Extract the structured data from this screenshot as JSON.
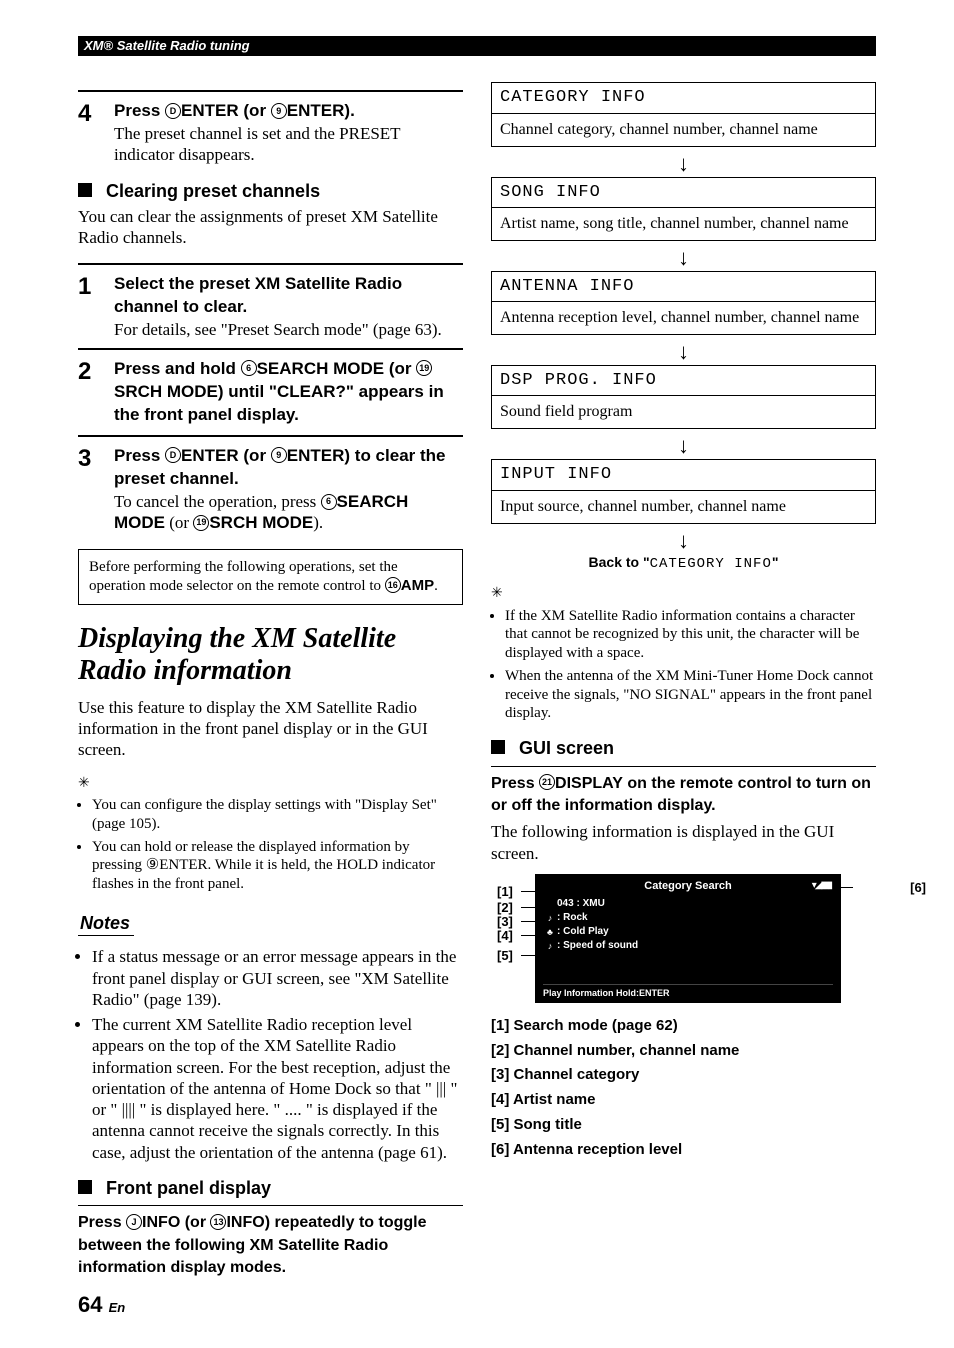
{
  "header": "XM® Satellite Radio tuning",
  "left": {
    "step4": {
      "num": "4",
      "head_pre": "Press ",
      "c1": "D",
      "b1": "ENTER",
      "mid": " (or ",
      "c2": "9",
      "b2": "ENTER",
      "post": ").",
      "body": "The preset channel is set and the PRESET indicator disappears."
    },
    "clearing": {
      "title": "Clearing preset channels",
      "intro": "You can clear the assignments of preset XM Satellite Radio channels."
    },
    "s1": {
      "num": "1",
      "head": "Select the preset XM Satellite Radio channel to clear.",
      "body": "For details, see \"Preset Search mode\" (page 63)."
    },
    "s2": {
      "num": "2",
      "head_pre": "Press and hold ",
      "c1": "6",
      "b1": "SEARCH MODE",
      "mid": " (or ",
      "c2": "19",
      "b2": "SRCH MODE",
      "post": ") until \"CLEAR?\" appears in the front panel display."
    },
    "s3": {
      "num": "3",
      "head_pre": "Press ",
      "c1": "D",
      "b1": "ENTER",
      "mid": " (or ",
      "c2": "9",
      "b2": "ENTER",
      "post": ") to clear the preset channel.",
      "body_pre": "To cancel the operation, press ",
      "bc1": "6",
      "bb1": "SEARCH MODE",
      "body_mid": " (or ",
      "bc2": "19",
      "bb2": "SRCH MODE",
      "body_post": ")."
    },
    "note_box_pre": "Before performing the following operations, set the operation mode selector on the remote control to ",
    "note_circ": "16",
    "note_amp": "AMP",
    "note_post": ".",
    "feature_title": "Displaying the XM Satellite Radio information",
    "feature_intro": "Use this feature to display the XM Satellite Radio information in the front panel display or in the GUI screen.",
    "tips": [
      "You can configure the display settings with \"Display Set\" (page 105).",
      "You can hold or release the displayed information by pressing ⑨ENTER. While it is held, the HOLD indicator flashes in the front panel."
    ],
    "notes_label": "Notes",
    "notes": [
      "If a status message or an error message appears in the front panel display or GUI screen, see \"XM Satellite Radio\" (page 139).",
      "The current XM Satellite Radio reception level appears on the top of the XM Satellite Radio information screen. For the best reception, adjust the orientation of the antenna of Home Dock so that \" ||| \" or \" |||| \" is displayed here. \" .... \" is displayed if the antenna cannot receive the signals correctly. In this case, adjust the orientation of the antenna (page 61)."
    ],
    "fpd_title": "Front panel display",
    "fpd_instr_pre": "Press ",
    "fpd_c1": "J",
    "fpd_b1": "INFO",
    "fpd_mid": " (or ",
    "fpd_c2": "13",
    "fpd_b2": "INFO",
    "fpd_post": ") repeatedly to toggle between the following XM Satellite Radio information display modes."
  },
  "right": {
    "blocks": [
      {
        "head": "CATEGORY INFO",
        "body": "Channel category, channel number, channel name"
      },
      {
        "head": "SONG INFO",
        "body": "Artist name, song title, channel number, channel name"
      },
      {
        "head": "ANTENNA INFO",
        "body": "Antenna reception level, channel number, channel name"
      },
      {
        "head": "DSP PROG. INFO",
        "body": "Sound field program"
      },
      {
        "head": "INPUT INFO",
        "body": "Input source, channel number, channel name"
      }
    ],
    "backto_pre": "Back to \"",
    "backto_mono": "CATEGORY INFO",
    "backto_post": "\"",
    "tips": [
      "If the XM Satellite Radio information contains a character that cannot be recognized by this unit, the character will be displayed with a space.",
      "When the antenna of the XM Mini-Tuner Home Dock cannot receive the signals, \"NO SIGNAL\" appears in the front panel display."
    ],
    "gui_title": "GUI screen",
    "gui_instr_pre": "Press ",
    "gui_c": "21",
    "gui_b": "DISPLAY",
    "gui_post": " on the remote control to turn on or off the information display.",
    "gui_follow": "The following information is displayed in the GUI screen.",
    "gui": {
      "title": "Category Search",
      "rows": [
        {
          "ic": "",
          "tx": "043  : XMU"
        },
        {
          "ic": "♪",
          "tx": ": Rock"
        },
        {
          "ic": "♣",
          "tx": ": Cold Play"
        },
        {
          "ic": "♪",
          "tx": ": Speed of sound"
        }
      ],
      "foot": "Play Information      Hold:ENTER",
      "ant": "▾◢▮▮▮"
    },
    "callouts": {
      "l1": "[1]",
      "l2": "[2]",
      "l3": "[3]",
      "l4": "[4]",
      "l5": "[5]",
      "r6": "[6]"
    },
    "defs": [
      "[1] Search mode (page 62)",
      "[2] Channel number, channel name",
      "[3] Channel category",
      "[4] Artist name",
      "[5] Song title",
      "[6] Antenna reception level"
    ]
  },
  "page": {
    "num": "64",
    "suf": "En"
  }
}
